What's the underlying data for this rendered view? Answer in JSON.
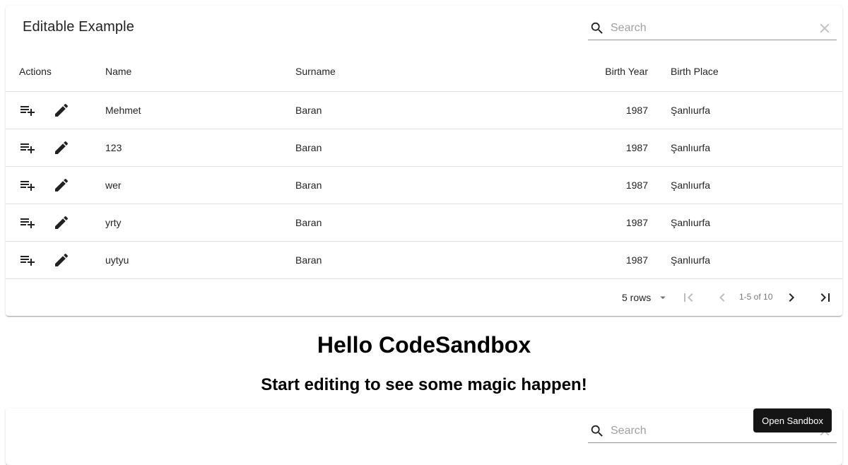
{
  "table": {
    "title": "Editable Example",
    "search_placeholder": "Search",
    "columns": [
      "Actions",
      "Name",
      "Surname",
      "Birth Year",
      "Birth Place"
    ],
    "rows": [
      {
        "name": "Mehmet",
        "surname": "Baran",
        "birth_year": "1987",
        "birth_place": "Şanlıurfa"
      },
      {
        "name": "123",
        "surname": "Baran",
        "birth_year": "1987",
        "birth_place": "Şanlıurfa"
      },
      {
        "name": "wer",
        "surname": "Baran",
        "birth_year": "1987",
        "birth_place": "Şanlıurfa"
      },
      {
        "name": "yrty",
        "surname": "Baran",
        "birth_year": "1987",
        "birth_place": "Şanlıurfa"
      },
      {
        "name": "uytyu",
        "surname": "Baran",
        "birth_year": "1987",
        "birth_place": "Şanlıurfa"
      }
    ],
    "row_actions": [
      "add-row-icon",
      "edit-icon"
    ],
    "pagination": {
      "rows_label": "5 rows",
      "range_label": "1-5 of 10"
    }
  },
  "page": {
    "heading": "Hello CodeSandbox",
    "subheading": "Start editing to see some magic happen!"
  },
  "second_table": {
    "search_placeholder": "Search"
  },
  "overlay": {
    "open_sandbox_label": "Open Sandbox"
  }
}
